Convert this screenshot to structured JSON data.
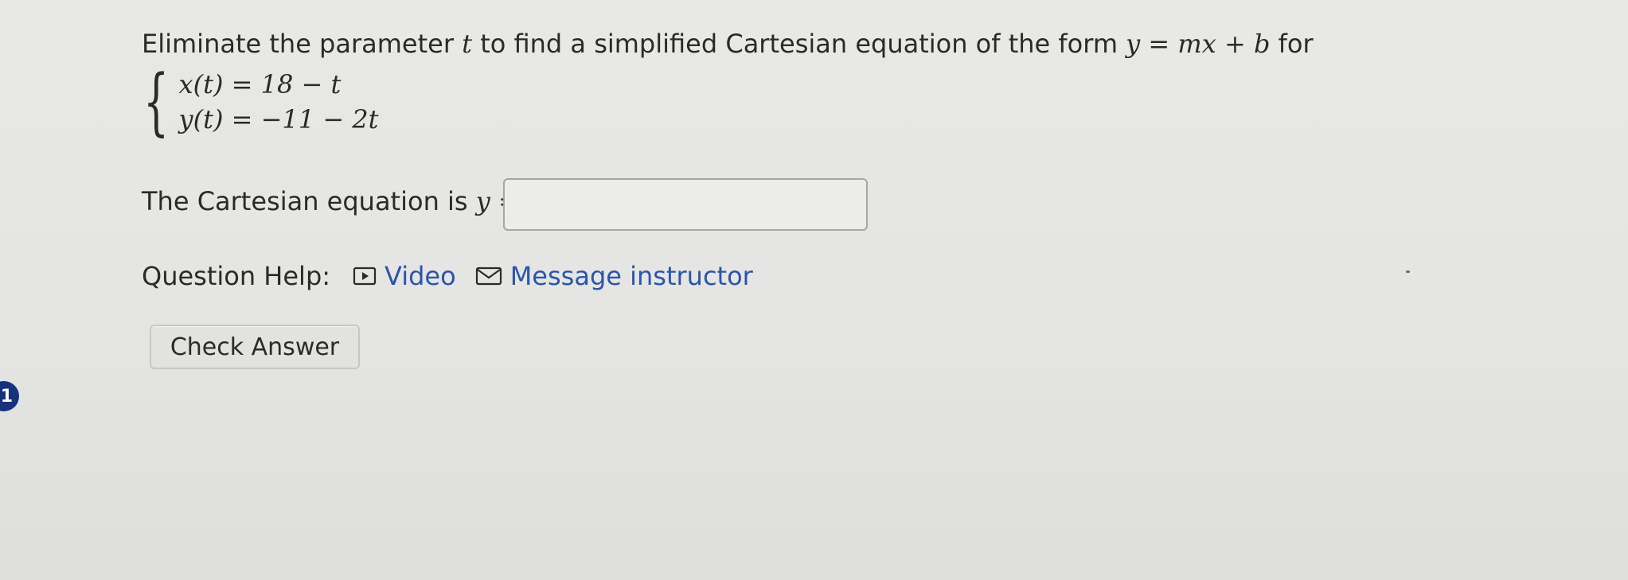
{
  "question": {
    "prompt_text": "Eliminate the parameter ",
    "prompt_var_t": "t",
    "prompt_mid": " to find a simplified Cartesian equation of the form ",
    "prompt_form": "y = mx + b",
    "prompt_end": " for",
    "equations": [
      "x(t) = 18 − t",
      "y(t) = −11 − 2t"
    ]
  },
  "answer": {
    "label": "The Cartesian equation is ",
    "var": "y",
    "equals": " =",
    "value": "",
    "placeholder": ""
  },
  "help": {
    "label": "Question Help:",
    "video_label": "Video",
    "message_label": "Message instructor"
  },
  "actions": {
    "check_answer_label": "Check Answer"
  },
  "side_badge": {
    "number": "1"
  },
  "colors": {
    "link": "#2a55a8",
    "badge": "#17327a"
  }
}
